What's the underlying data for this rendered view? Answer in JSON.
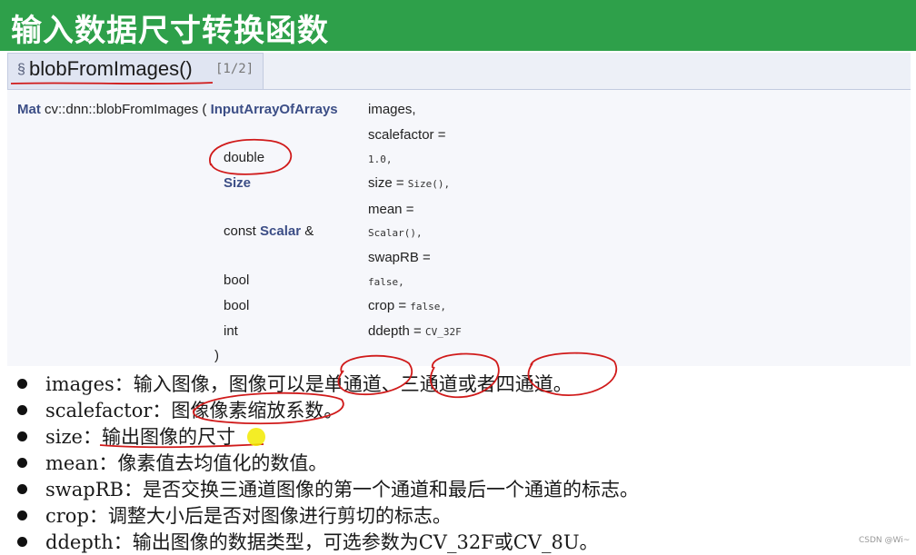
{
  "header": {
    "title": "输入数据尺寸转换函数"
  },
  "func": {
    "sect": "§",
    "name": "blobFromImages()",
    "page": "[1/2]"
  },
  "signature": {
    "ret": "Mat",
    "qual": " cv::dnn::blobFromImages ( ",
    "input_type": "InputArrayOfArrays",
    "images": "images,",
    "scalefactor_label": "scalefactor =",
    "double": "double",
    "scalefactor_default": "1.0,",
    "size_type": "Size",
    "size_label": "size = ",
    "size_default": "Size(),",
    "mean_label": "mean =",
    "const": "const ",
    "scalar": "Scalar",
    "amp": " &",
    "mean_default": "Scalar(),",
    "swaprb_label": "swapRB =",
    "bool": "bool",
    "swaprb_default": "false,",
    "crop_label": "crop = ",
    "crop_default": "false,",
    "int": "int",
    "ddepth_label": "ddepth = ",
    "ddepth_default": "CV_32F",
    "close": ")"
  },
  "bullets": [
    "images：输入图像，图像可以是单通道、三通道或者四通道。",
    "scalefactor：图像像素缩放系数。",
    "size：输出图像的尺寸",
    "mean：像素值去均值化的数值。",
    "swapRB：是否交换三通道图像的第一个通道和最后一个通道的标志。",
    "crop：调整大小后是否对图像进行剪切的标志。",
    "ddepth：输出图像的数据类型，可选参数为CV_32F或CV_8U。"
  ],
  "watermark": "CSDN @Wi~",
  "colors": {
    "title_bg": "#2ea04a",
    "annotation": "#d01a1a",
    "highlight": "#f2ea00"
  }
}
